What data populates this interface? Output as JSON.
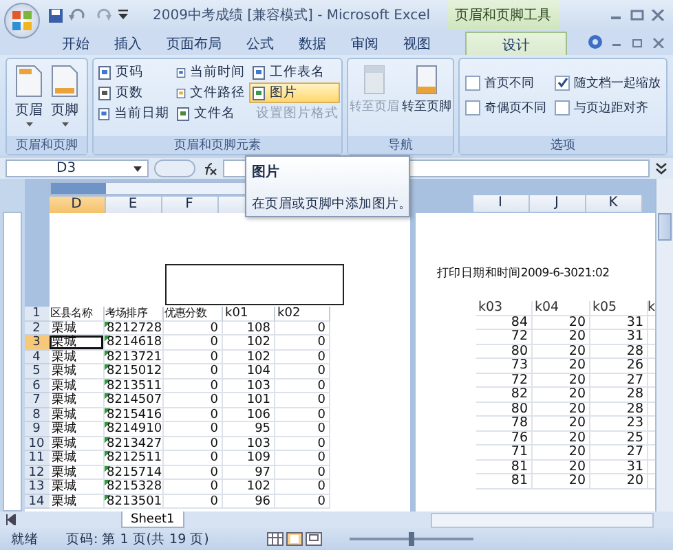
{
  "title_bar": {
    "title": "2009中考成绩  [兼容模式] - Microsoft Excel",
    "context_tab": "页眉和页脚工具"
  },
  "tabs": [
    {
      "label": "开始",
      "selected": false
    },
    {
      "label": "插入",
      "selected": false
    },
    {
      "label": "页面布局",
      "selected": false
    },
    {
      "label": "公式",
      "selected": false
    },
    {
      "label": "数据",
      "selected": false
    },
    {
      "label": "审阅",
      "selected": false
    },
    {
      "label": "视图",
      "selected": false
    },
    {
      "label": "设计",
      "selected": true
    }
  ],
  "ribbon": {
    "groups": [
      {
        "label": "页眉和页脚",
        "kind": "large",
        "buttons": [
          {
            "label": "页眉",
            "disabled": false
          },
          {
            "label": "页脚",
            "disabled": false
          }
        ]
      },
      {
        "label": "页眉和页脚元素",
        "kind": "small",
        "buttons": [
          {
            "label": "页码",
            "disabled": false,
            "hovered": false
          },
          {
            "label": "当前时间",
            "disabled": false,
            "hovered": false
          },
          {
            "label": "工作表名",
            "disabled": false,
            "hovered": false
          },
          {
            "label": "页数",
            "disabled": false,
            "hovered": false
          },
          {
            "label": "文件路径",
            "disabled": false,
            "hovered": false
          },
          {
            "label": "图片",
            "disabled": false,
            "hovered": true
          },
          {
            "label": "当前日期",
            "disabled": false,
            "hovered": false
          },
          {
            "label": "文件名",
            "disabled": false,
            "hovered": false
          },
          {
            "label": "设置图片格式",
            "disabled": true,
            "hovered": false
          }
        ]
      },
      {
        "label": "导航",
        "kind": "nav",
        "buttons": [
          {
            "label": "转至页眉",
            "disabled": true
          },
          {
            "label": "转至页脚",
            "disabled": false
          }
        ]
      },
      {
        "label": "选项",
        "kind": "checks",
        "options": [
          {
            "label": "首页不同",
            "checked": false
          },
          {
            "label": "奇偶页不同",
            "checked": false
          },
          {
            "label": "随文档一起缩放",
            "checked": true
          },
          {
            "label": "与页边距对齐",
            "checked": false
          }
        ]
      }
    ]
  },
  "formula_bar": {
    "name_box": "D3"
  },
  "tooltip": {
    "title": "图片",
    "text": "在页眉或页脚中添加图片。"
  },
  "left_page": {
    "column_headers": [
      {
        "label": "D",
        "selected": true
      },
      {
        "label": "E",
        "selected": false
      },
      {
        "label": "F",
        "selected": false
      }
    ],
    "rows": [
      {
        "number": "1",
        "selected": false,
        "cells": [
          "区县名称",
          "考场排序",
          "优惠分数",
          "k01",
          "k02"
        ]
      },
      {
        "number": "2",
        "selected": false,
        "cells": [
          "栗城",
          "8212728",
          "0",
          "108",
          "0"
        ]
      },
      {
        "number": "3",
        "selected": true,
        "cells": [
          "栗城",
          "8214618",
          "0",
          "102",
          "0"
        ]
      },
      {
        "number": "4",
        "selected": false,
        "cells": [
          "栗城",
          "8213721",
          "0",
          "102",
          "0"
        ]
      },
      {
        "number": "5",
        "selected": false,
        "cells": [
          "栗城",
          "8215012",
          "0",
          "104",
          "0"
        ]
      },
      {
        "number": "6",
        "selected": false,
        "cells": [
          "栗城",
          "8213511",
          "0",
          "103",
          "0"
        ]
      },
      {
        "number": "7",
        "selected": false,
        "cells": [
          "栗城",
          "8214507",
          "0",
          "101",
          "0"
        ]
      },
      {
        "number": "8",
        "selected": false,
        "cells": [
          "栗城",
          "8215416",
          "0",
          "106",
          "0"
        ]
      },
      {
        "number": "9",
        "selected": false,
        "cells": [
          "栗城",
          "8214910",
          "0",
          "95",
          "0"
        ]
      },
      {
        "number": "10",
        "selected": false,
        "cells": [
          "栗城",
          "8213427",
          "0",
          "103",
          "0"
        ]
      },
      {
        "number": "11",
        "selected": false,
        "cells": [
          "栗城",
          "8212511",
          "0",
          "109",
          "0"
        ]
      },
      {
        "number": "12",
        "selected": false,
        "cells": [
          "栗城",
          "8215714",
          "0",
          "97",
          "0"
        ]
      },
      {
        "number": "13",
        "selected": false,
        "cells": [
          "栗城",
          "8215328",
          "0",
          "102",
          "0"
        ]
      },
      {
        "number": "14",
        "selected": false,
        "cells": [
          "栗城",
          "8213501",
          "0",
          "96",
          "0"
        ]
      }
    ]
  },
  "right_page": {
    "column_headers": [
      "I",
      "J",
      "K"
    ],
    "header_text": "打印日期和时间2009-6-3021:02",
    "columns": [
      "k03",
      "k04",
      "k05",
      "k"
    ],
    "rows": [
      [
        "84",
        "20",
        "31"
      ],
      [
        "72",
        "20",
        "31"
      ],
      [
        "80",
        "20",
        "28"
      ],
      [
        "73",
        "20",
        "26"
      ],
      [
        "72",
        "20",
        "27"
      ],
      [
        "82",
        "20",
        "28"
      ],
      [
        "80",
        "20",
        "28"
      ],
      [
        "78",
        "20",
        "23"
      ],
      [
        "76",
        "20",
        "25"
      ],
      [
        "71",
        "20",
        "27"
      ],
      [
        "81",
        "20",
        "31"
      ],
      [
        "81",
        "20",
        "20"
      ]
    ]
  },
  "sheet_tabs": [
    {
      "label": "Sheet1",
      "selected": true
    }
  ],
  "status_bar": {
    "ready": "就绪",
    "page": "页码: 第 1 页(共 19 页)",
    "zoom": {
      "level": 0.5
    }
  }
}
